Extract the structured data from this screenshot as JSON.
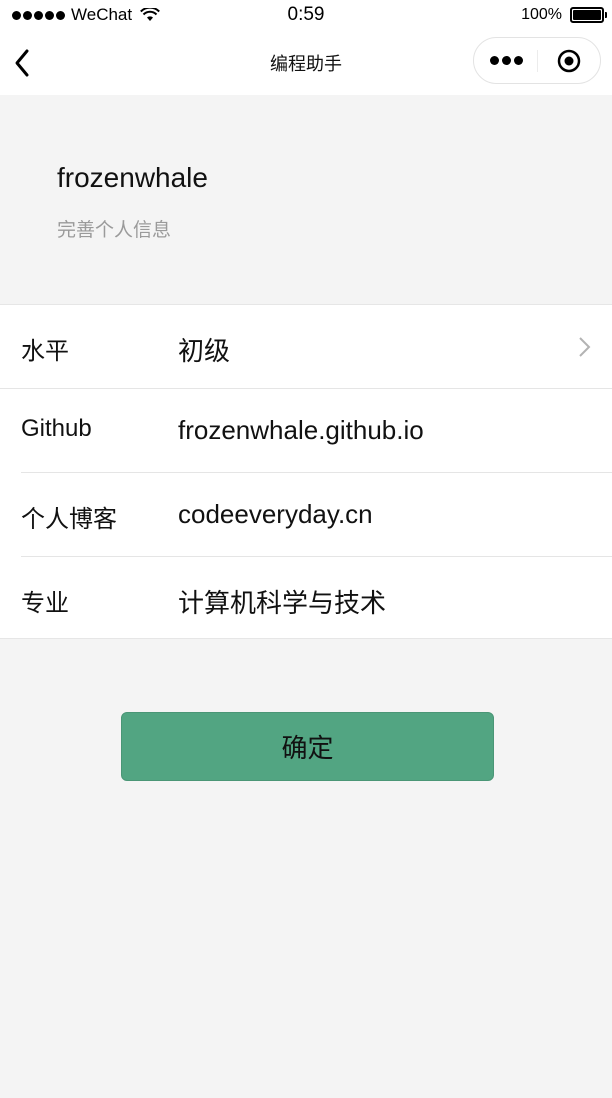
{
  "status_bar": {
    "carrier": "WeChat",
    "time": "0:59",
    "battery": "100%"
  },
  "nav": {
    "title": "编程助手"
  },
  "profile": {
    "username": "frozenwhale",
    "subtitle": "完善个人信息"
  },
  "form": {
    "rows": [
      {
        "label": "水平",
        "value": "初级"
      },
      {
        "label": "Github",
        "value": "frozenwhale.github.io"
      },
      {
        "label": "个人博客",
        "value": "codeeveryday.cn"
      },
      {
        "label": "专业",
        "value": "计算机科学与技术"
      }
    ]
  },
  "confirm_button": {
    "label": "确定",
    "color": "#52a582"
  },
  "icons": [
    "signal-dots-icon",
    "wifi-icon",
    "battery-icon",
    "back-chevron-icon",
    "more-icon",
    "close-target-icon",
    "chevron-right-icon"
  ]
}
